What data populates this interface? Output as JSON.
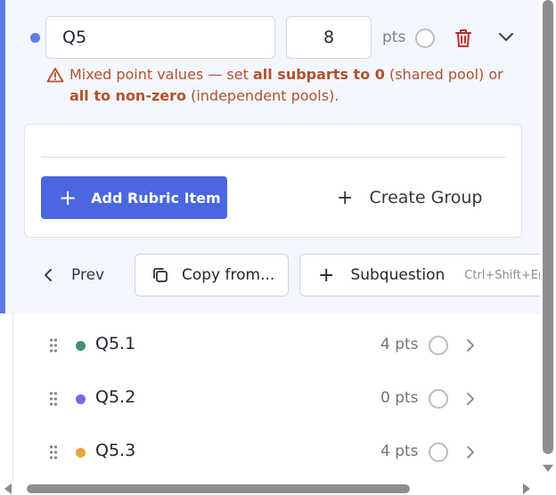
{
  "question": {
    "title_value": "Q5",
    "points_value": "8",
    "points_unit": "pts",
    "accent_color": "#5b7de6"
  },
  "warning": {
    "text_1": "Mixed point values — set ",
    "bold_1": "all subparts to 0",
    "text_2": " (shared pool) or ",
    "bold_2": "all to non-zero",
    "text_3": " (independent pools).",
    "color": "#b0522a",
    "icon": "warning-triangle-icon"
  },
  "rubric": {
    "add_label": "Add Rubric Item",
    "create_group_label": "Create Group"
  },
  "nav": {
    "prev_label": "Prev",
    "copy_label": "Copy from...",
    "subquestion_label": "Subquestion",
    "subquestion_shortcut": "Ctrl+Shift+En"
  },
  "subparts": [
    {
      "title": "Q5.1",
      "points": "4 pts",
      "dot_color": "#3f8f7a"
    },
    {
      "title": "Q5.2",
      "points": "0 pts",
      "dot_color": "#8b5cf0"
    },
    {
      "title": "Q5.3",
      "points": "4 pts",
      "dot_color": "#e8a33a"
    }
  ]
}
